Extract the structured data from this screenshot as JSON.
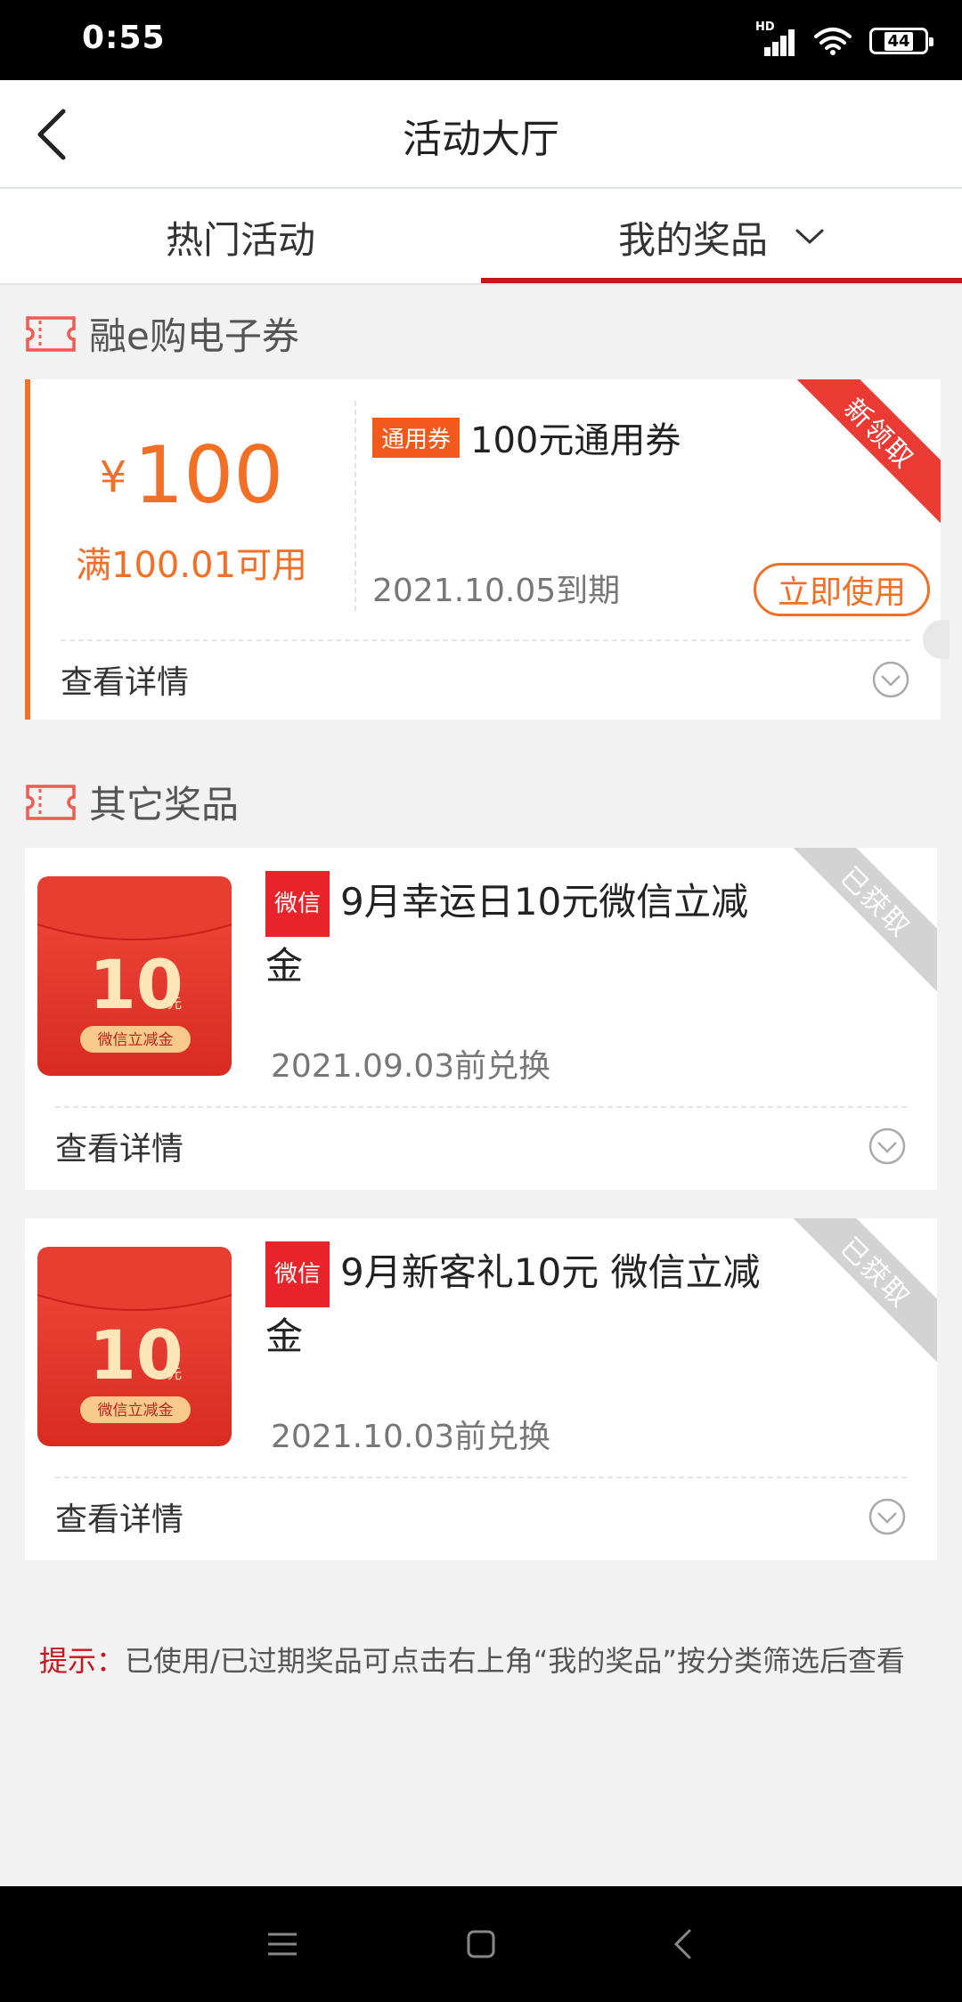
{
  "status": {
    "time": "0:55",
    "network": "HD",
    "battery": "44"
  },
  "nav": {
    "title": "活动大厅"
  },
  "tabs": [
    {
      "label": "热门活动"
    },
    {
      "label": "我的奖品"
    }
  ],
  "sections": [
    {
      "title": "融e购电子券"
    },
    {
      "title": "其它奖品"
    }
  ],
  "coupon": {
    "currency": "¥",
    "amount": "100",
    "condition": "满100.01可用",
    "tag": "通用券",
    "title": "100元通用券",
    "expiry": "2021.10.05到期",
    "use_label": "立即使用",
    "ribbon": "新领取",
    "detail_label": "查看详情"
  },
  "prizes": [
    {
      "tag": "微信",
      "title": "9月幸运日10元微信立减金",
      "date": "2021.09.03前兑换",
      "ribbon": "已获取",
      "detail_label": "查看详情",
      "image_amount": "10",
      "image_unit": "元",
      "image_label": "微信立减金"
    },
    {
      "tag": "微信",
      "title": "9月新客礼10元 微信立减金",
      "date": "2021.10.03前兑换",
      "ribbon": "已获取",
      "detail_label": "查看详情",
      "image_amount": "10",
      "image_unit": "元",
      "image_label": "微信立减金"
    }
  ],
  "tip": {
    "label": "提示：",
    "text": "已使用/已过期奖品可点击右上角“我的奖品”按分类筛选后查看"
  },
  "colors": {
    "brand_red": "#c8161d",
    "coupon_orange": "#f36f26",
    "ribbon_new": "#ea3a33",
    "ribbon_got": "#d3d3d3",
    "wechat_tag": "#e8232a"
  }
}
